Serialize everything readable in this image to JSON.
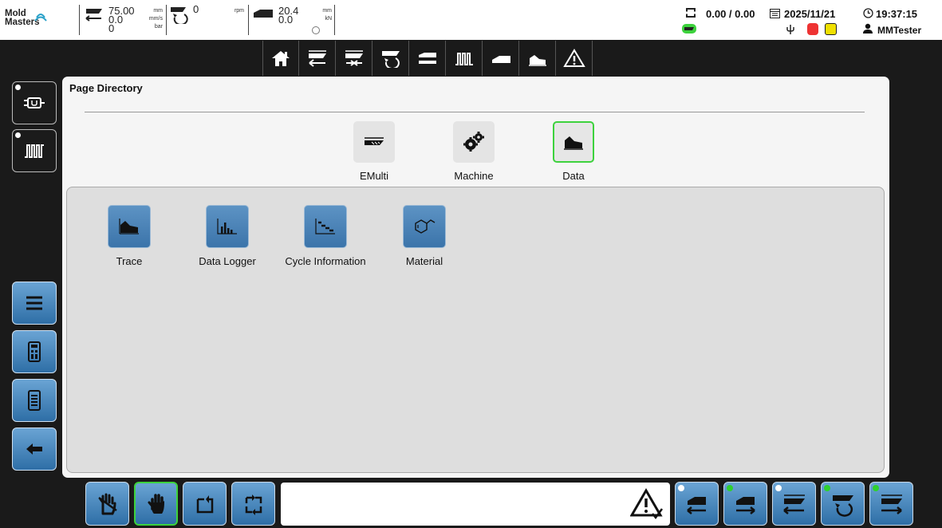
{
  "status": {
    "logo_line1": "Mold",
    "logo_line2": "Masters",
    "injection": {
      "position": "75.00",
      "speed": "0.0",
      "pressure": "0",
      "unit_position": "mm",
      "unit_speed": "mm/s",
      "unit_pressure": "bar"
    },
    "screw": {
      "rpm": "0",
      "unit_rpm": "rpm"
    },
    "carriage": {
      "position": "20.4",
      "force": "0.0",
      "unit_position": "mm",
      "unit_force": "kN"
    },
    "shot_values": "0.00 / 0.00",
    "date": "2025/11/21",
    "time": "19:37:15",
    "user": "MMTester"
  },
  "topnav": {
    "icons": [
      "home-icon",
      "injection-back-icon",
      "injection-hold-icon",
      "screw-rotate-icon",
      "nozzle-icon",
      "heater-icon",
      "carriage-icon",
      "data-chart-icon",
      "alarm-warning-icon"
    ]
  },
  "left_rail": {
    "icons": [
      "power-icon",
      "heater-icon",
      "menu-icon",
      "calculator-icon",
      "document-icon",
      "back-arrow-icon"
    ]
  },
  "main": {
    "title": "Page Directory",
    "categories": [
      {
        "label": "EMulti",
        "icon": "emulti-icon",
        "active": false
      },
      {
        "label": "Machine",
        "icon": "gears-icon",
        "active": false
      },
      {
        "label": "Data",
        "icon": "area-chart-icon",
        "active": true
      }
    ],
    "items": [
      {
        "label": "Trace",
        "icon": "area-chart-icon"
      },
      {
        "label": "Data Logger",
        "icon": "bar-chart-icon"
      },
      {
        "label": "Cycle Information",
        "icon": "step-chart-icon"
      },
      {
        "label": "Material",
        "icon": "molecule-icon"
      }
    ]
  },
  "bottom": {
    "left_buttons": [
      "manual-hand-icon",
      "hand-icon",
      "single-cycle-icon",
      "auto-cycle-icon"
    ],
    "selected": "hand-icon",
    "right_buttons": [
      "carriage-back-icon",
      "carriage-forward-icon",
      "injection-back-icon",
      "screw-rotate-icon",
      "injection-forward-icon"
    ],
    "alarm_icon": "alarm-acknowledged-icon"
  },
  "colors": {
    "accent": "#3b74aa",
    "active_border": "#3dd23d",
    "panel": "#f5f5f5",
    "background": "#1a1a1a"
  }
}
